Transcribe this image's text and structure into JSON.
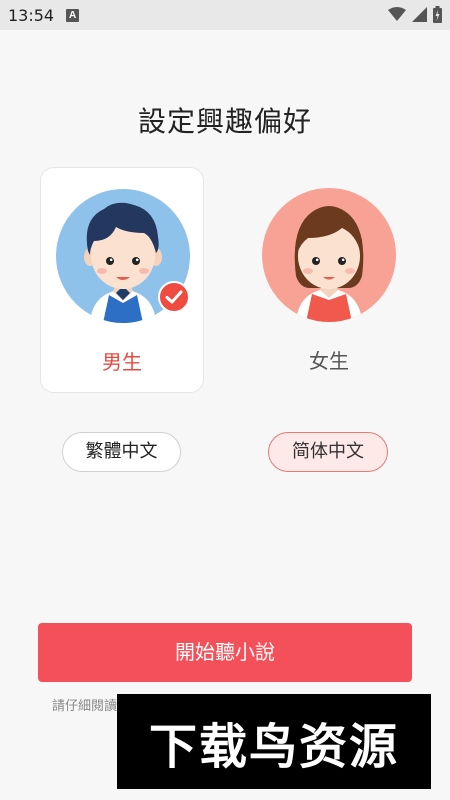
{
  "status_bar": {
    "time": "13:54",
    "app_icon_letter": "A",
    "icons": [
      "wifi-icon",
      "signal-icon",
      "battery-icon"
    ]
  },
  "page": {
    "title": "設定興趣偏好"
  },
  "gender_options": {
    "male": {
      "label": "男生",
      "selected": true
    },
    "female": {
      "label": "女生",
      "selected": false
    }
  },
  "language_options": {
    "traditional": {
      "label": "繁體中文",
      "selected": false
    },
    "simplified": {
      "label": "简体中文",
      "selected": true
    }
  },
  "actions": {
    "start_label": "開始聽小說"
  },
  "footer": {
    "notice": "請仔細閱讀"
  },
  "watermark": {
    "text": "下载鸟资源"
  },
  "colors": {
    "accent": "#f4505a",
    "selected_text": "#e94a40",
    "male_avatar_bg": "#8fc2ea",
    "female_avatar_bg": "#f7a294"
  }
}
